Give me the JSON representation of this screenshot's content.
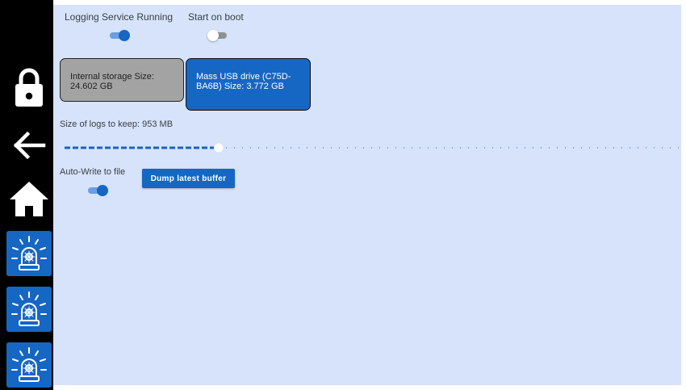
{
  "settings": {
    "logging_service_label": "Logging Service Running",
    "logging_service_on": true,
    "start_on_boot_label": "Start on boot",
    "start_on_boot_on": false,
    "auto_write_label": "Auto-Write to file",
    "auto_write_on": true
  },
  "storage": {
    "internal_label": "Internal storage Size: 24.602 GB",
    "usb_label": "Mass USB drive (C75D-BA6B) Size: 3.772 GB",
    "selected": "usb"
  },
  "log_size": {
    "label": "Size of logs to keep: 953 MB",
    "slider_fraction": 0.25
  },
  "actions": {
    "dump_buffer_label": "Dump latest buffer"
  },
  "sidebar": {
    "items": [
      {
        "icon": "lock-icon"
      },
      {
        "icon": "back-arrow-icon"
      },
      {
        "icon": "home-icon"
      },
      {
        "icon": "alarm-siren-icon"
      },
      {
        "icon": "alarm-siren-icon"
      },
      {
        "icon": "alarm-siren-icon"
      }
    ]
  },
  "colors": {
    "accent": "#1666c4",
    "background": "#d6e3fa",
    "sidebar": "#000000"
  }
}
